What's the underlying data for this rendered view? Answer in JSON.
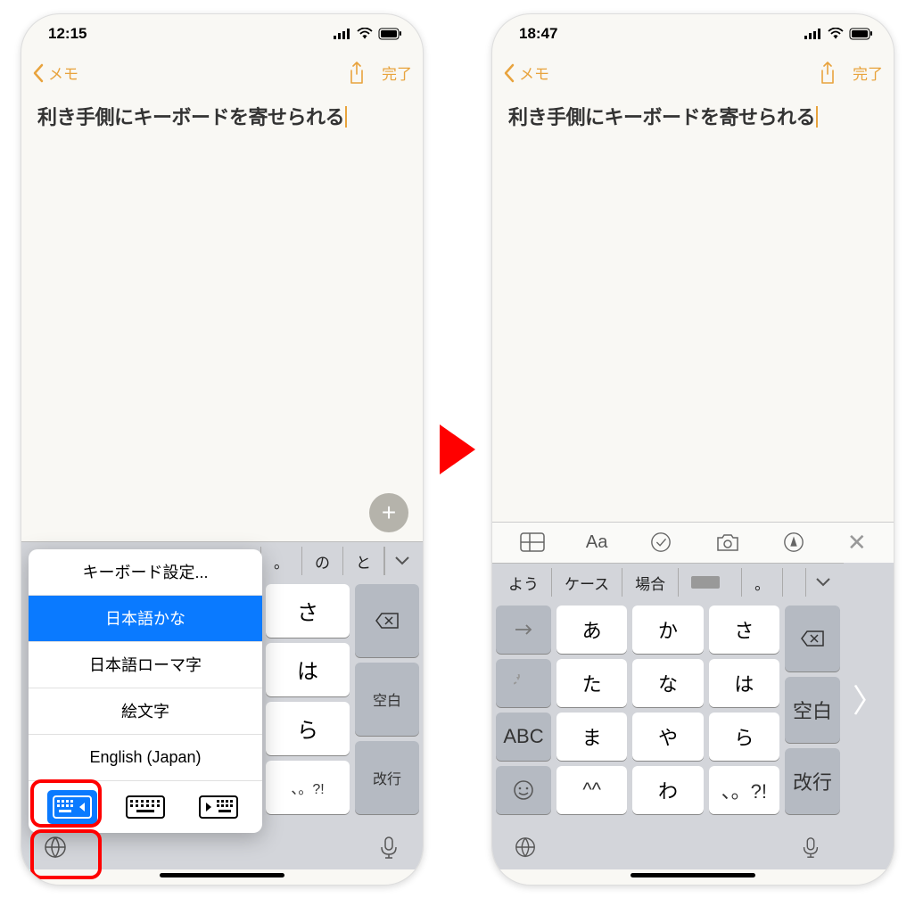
{
  "left": {
    "status_time": "12:15",
    "back_label": "メモ",
    "done_label": "完了",
    "note_text": "利き手側にキーボードを寄せられる",
    "menu": {
      "settings": "キーボード設定...",
      "kana": "日本語かな",
      "romaji": "日本語ローマ字",
      "emoji": "絵文字",
      "english": "English (Japan)"
    },
    "suggest": [
      "、",
      "。",
      "の",
      "と"
    ],
    "keys": {
      "sa": "さ",
      "ha": "は",
      "ra": "ら",
      "punct": "、。?!",
      "space": "空白",
      "return": "改行"
    }
  },
  "right": {
    "status_time": "18:47",
    "back_label": "メモ",
    "done_label": "完了",
    "note_text": "利き手側にキーボードを寄せられる",
    "toolbar_aa": "Aa",
    "suggest": [
      "よう",
      "ケース",
      "場合"
    ],
    "suggest_punct": "。",
    "keys": {
      "a": "あ",
      "ka": "か",
      "sa": "さ",
      "ta": "た",
      "na": "な",
      "ha": "は",
      "ma": "ま",
      "ya": "や",
      "ra": "ら",
      "wa": "わ",
      "small": "^^",
      "punct": "、。?!",
      "abc": "ABC",
      "space": "空白",
      "return": "改行"
    }
  }
}
